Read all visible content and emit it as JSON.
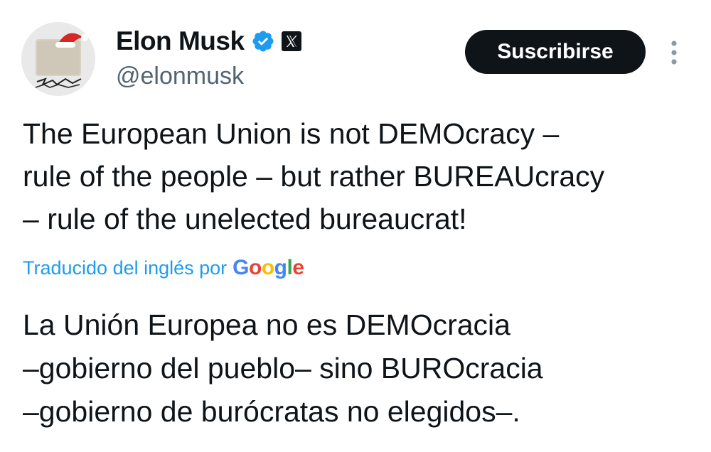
{
  "author": {
    "display_name": "Elon Musk",
    "handle": "@elonmusk",
    "verified_icon": "verified-badge-icon",
    "affiliation_icon": "x-logo-icon"
  },
  "header": {
    "subscribe_label": "Suscribirse",
    "more_icon": "more-vertical-icon"
  },
  "tweet": {
    "text": "The European Union is not DEMOcracy –\nrule of the people – but rather BUREAUcracy\n– rule of the unelected bureaucrat!",
    "translation_label": "Traducido del inglés por",
    "translation_provider": "Google",
    "translated_text": "La Unión Europea no es DEMOcracia\n–gobierno del pueblo– sino BUROcracia\n–gobierno de burócratas no elegidos–."
  },
  "colors": {
    "verified_blue": "#1d9bf0",
    "handle_gray": "#536471",
    "button_black": "#0f1419",
    "google_blue": "#4285f4",
    "google_red": "#ea4335",
    "google_yellow": "#fbbc05",
    "google_green": "#34a853"
  }
}
